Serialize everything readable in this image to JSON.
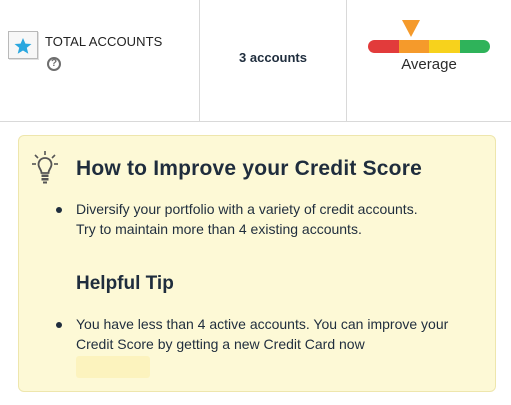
{
  "accounts": {
    "label": "TOTAL ACCOUNTS",
    "help_icon": "question-circle-icon",
    "icon": "star-card-icon",
    "count": "3 accounts"
  },
  "rating": {
    "label": "Average",
    "level": "Average",
    "segments": [
      "#e23b3b",
      "#f59a2b",
      "#f7d21c",
      "#2fb35a"
    ],
    "pointer_color": "#f59a2b"
  },
  "tips": {
    "icon": "lightbulb-icon",
    "title": "How to Improve your Credit Score",
    "items": [
      "Diversify your portfolio with a variety of credit accounts. Try to maintain more than 4 existing accounts."
    ],
    "helpful_tip_title": "Helpful Tip",
    "helpful_items": [
      "You have less than 4 active accounts. You can improve your Credit Score by getting a new Credit Card now"
    ]
  }
}
